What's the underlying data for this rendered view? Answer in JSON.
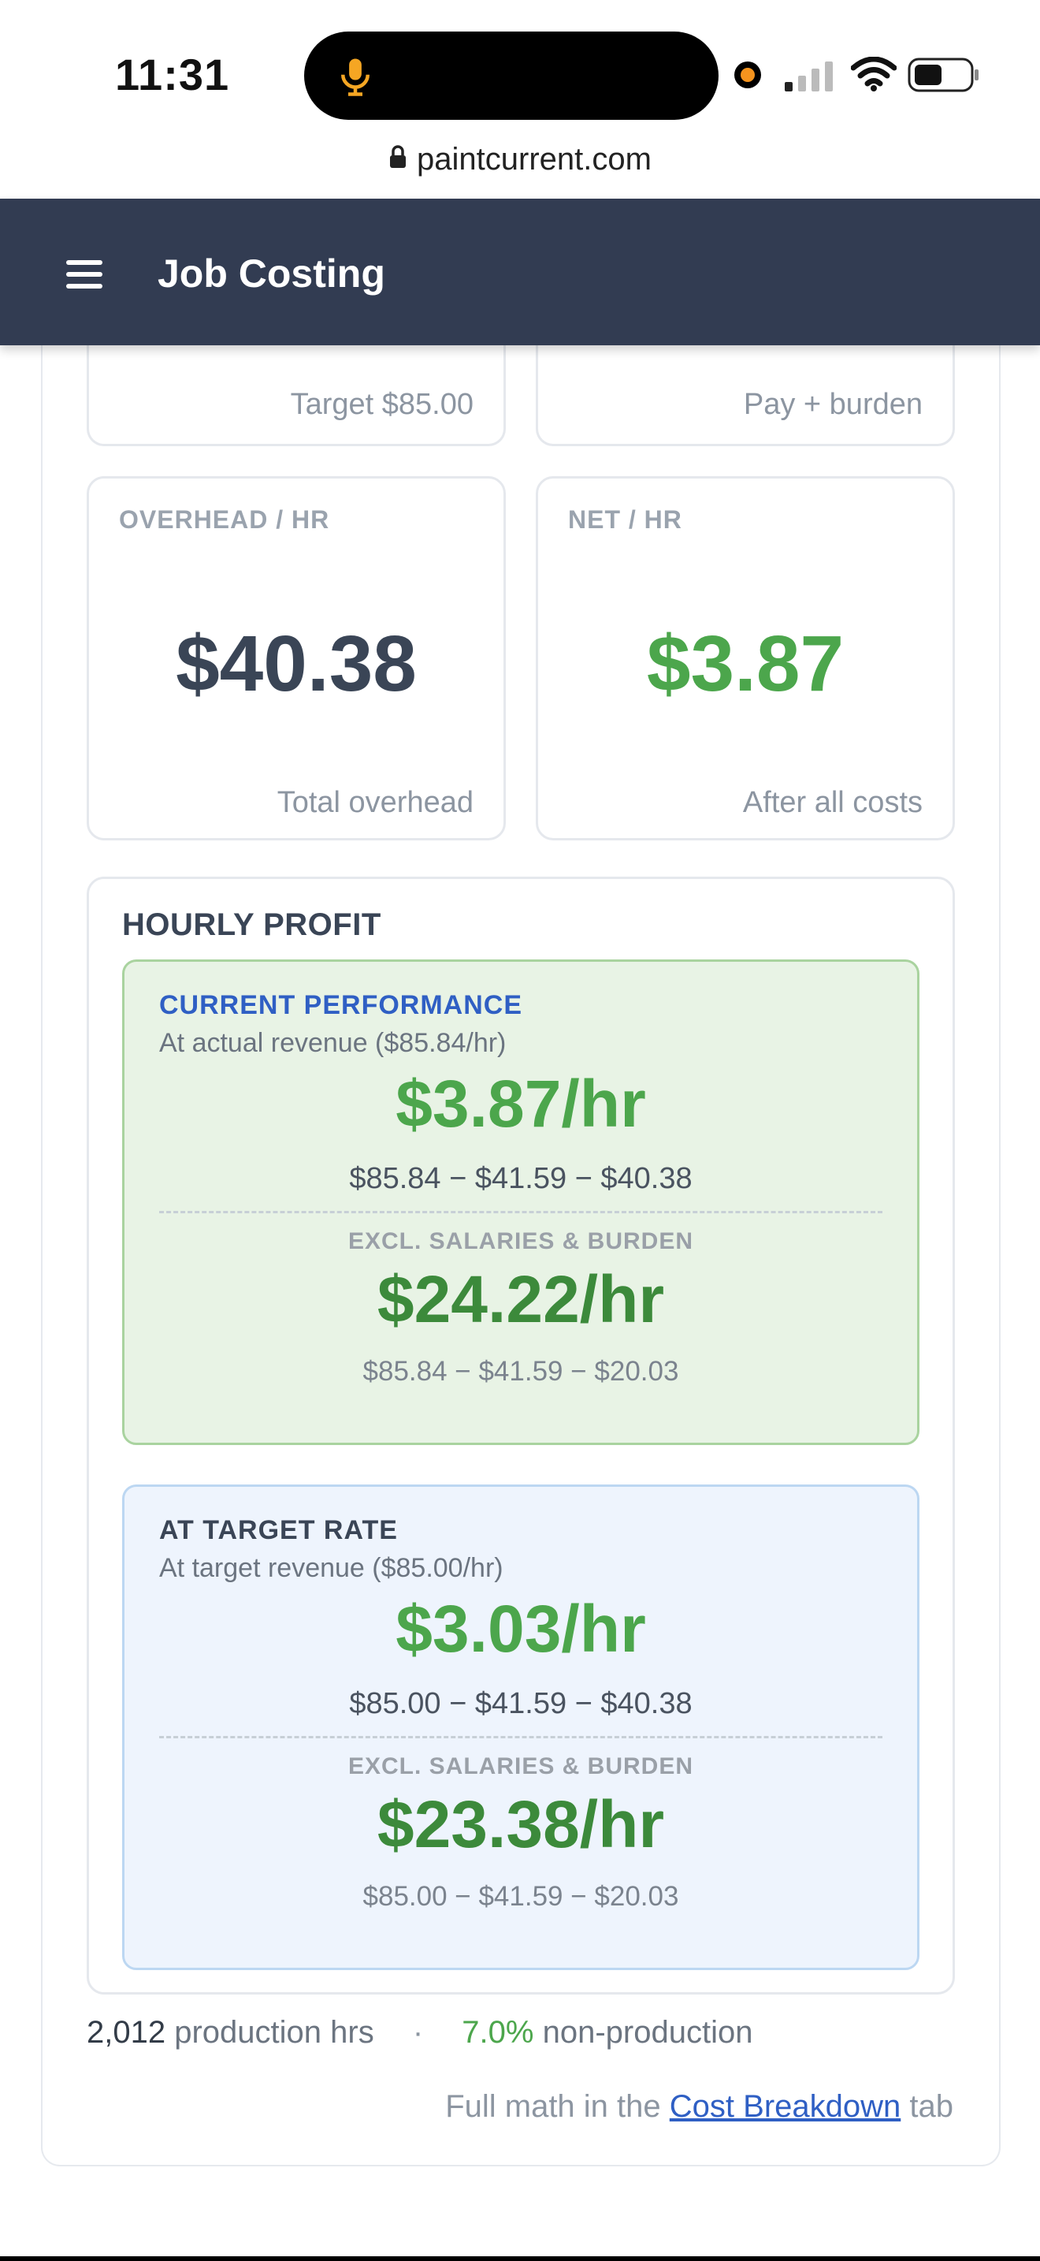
{
  "status_bar": {
    "time": "11:31",
    "url": "paintcurrent.com"
  },
  "header": {
    "title": "Job Costing"
  },
  "partial_cards": {
    "left_note": "Target $85.00",
    "right_note": "Pay + burden"
  },
  "metrics": {
    "overhead": {
      "label": "OVERHEAD / HR",
      "value": "$40.38",
      "note": "Total overhead",
      "color": "#3a4556"
    },
    "net": {
      "label": "NET / HR",
      "value": "$3.87",
      "note": "After all costs",
      "color": "#4ca64c"
    }
  },
  "hourly_profit": {
    "title": "HOURLY PROFIT",
    "current": {
      "title": "CURRENT PERFORMANCE",
      "title_color": "#2f5fc4",
      "subtitle": "At actual revenue ($85.84/hr)",
      "value": "$3.87/hr",
      "math": "$85.84 − $41.59 − $40.38",
      "excl_label": "EXCL. SALARIES & BURDEN",
      "excl_value": "$24.22/hr",
      "excl_math": "$85.84 − $41.59 − $20.03"
    },
    "target": {
      "title": "AT TARGET RATE",
      "title_color": "#3a4556",
      "subtitle": "At target revenue ($85.00/hr)",
      "value": "$3.03/hr",
      "math": "$85.00 − $41.59 − $40.38",
      "excl_label": "EXCL. SALARIES & BURDEN",
      "excl_value": "$23.38/hr",
      "excl_math": "$85.00 − $41.59 − $20.03"
    }
  },
  "footer": {
    "hours_value": "2,012",
    "hours_label": "production hrs",
    "separator": "·",
    "nonprod_pct": "7.0%",
    "nonprod_label": "non-production",
    "link_prefix": "Full math in the",
    "link_text": "Cost Breakdown",
    "link_suffix": "tab"
  }
}
